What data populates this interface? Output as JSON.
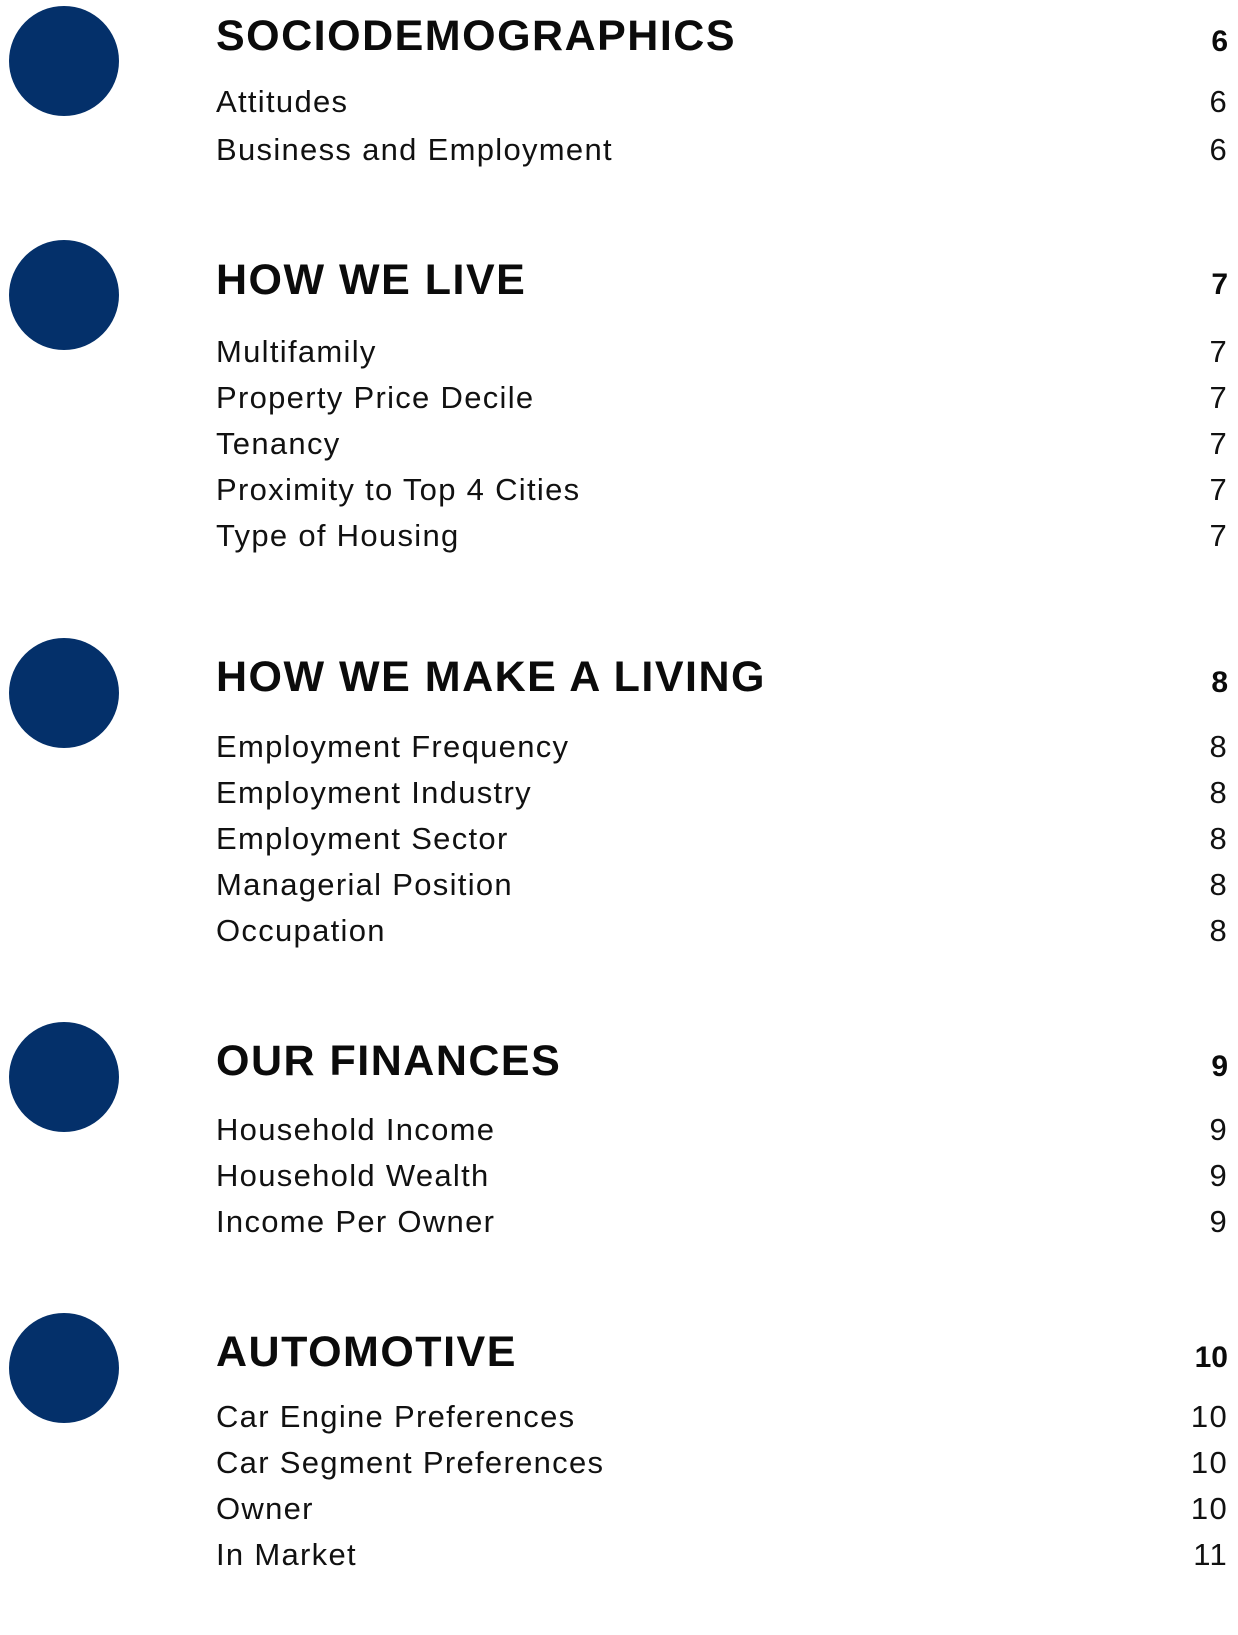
{
  "colors": {
    "bullet": "#04306a",
    "text": "#111111"
  },
  "sections": [
    {
      "title": "SOCIODEMOGRAPHICS",
      "page": "6",
      "items": [
        {
          "label": "Attitudes",
          "page": "6"
        },
        {
          "label": "Business and Employment",
          "page": "6"
        }
      ]
    },
    {
      "title": "HOW WE LIVE",
      "page": "7",
      "items": [
        {
          "label": "Multifamily",
          "page": "7"
        },
        {
          "label": "Property Price Decile",
          "page": "7"
        },
        {
          "label": "Tenancy",
          "page": "7"
        },
        {
          "label": "Proximity to Top 4 Cities",
          "page": "7"
        },
        {
          "label": "Type of Housing",
          "page": "7"
        }
      ]
    },
    {
      "title": "HOW WE MAKE A LIVING",
      "page": "8",
      "items": [
        {
          "label": "Employment Frequency",
          "page": "8"
        },
        {
          "label": "Employment Industry",
          "page": "8"
        },
        {
          "label": "Employment Sector",
          "page": "8"
        },
        {
          "label": "Managerial Position",
          "page": "8"
        },
        {
          "label": "Occupation",
          "page": "8"
        }
      ]
    },
    {
      "title": "OUR FINANCES",
      "page": "9",
      "items": [
        {
          "label": "Household Income",
          "page": "9"
        },
        {
          "label": "Household Wealth",
          "page": "9"
        },
        {
          "label": "Income Per Owner",
          "page": "9"
        }
      ]
    },
    {
      "title": "AUTOMOTIVE",
      "page": "10",
      "items": [
        {
          "label": "Car Engine Preferences",
          "page": "10"
        },
        {
          "label": "Car Segment Preferences",
          "page": "10"
        },
        {
          "label": "Owner",
          "page": "10"
        },
        {
          "label": "In Market",
          "page": "11"
        }
      ]
    }
  ]
}
